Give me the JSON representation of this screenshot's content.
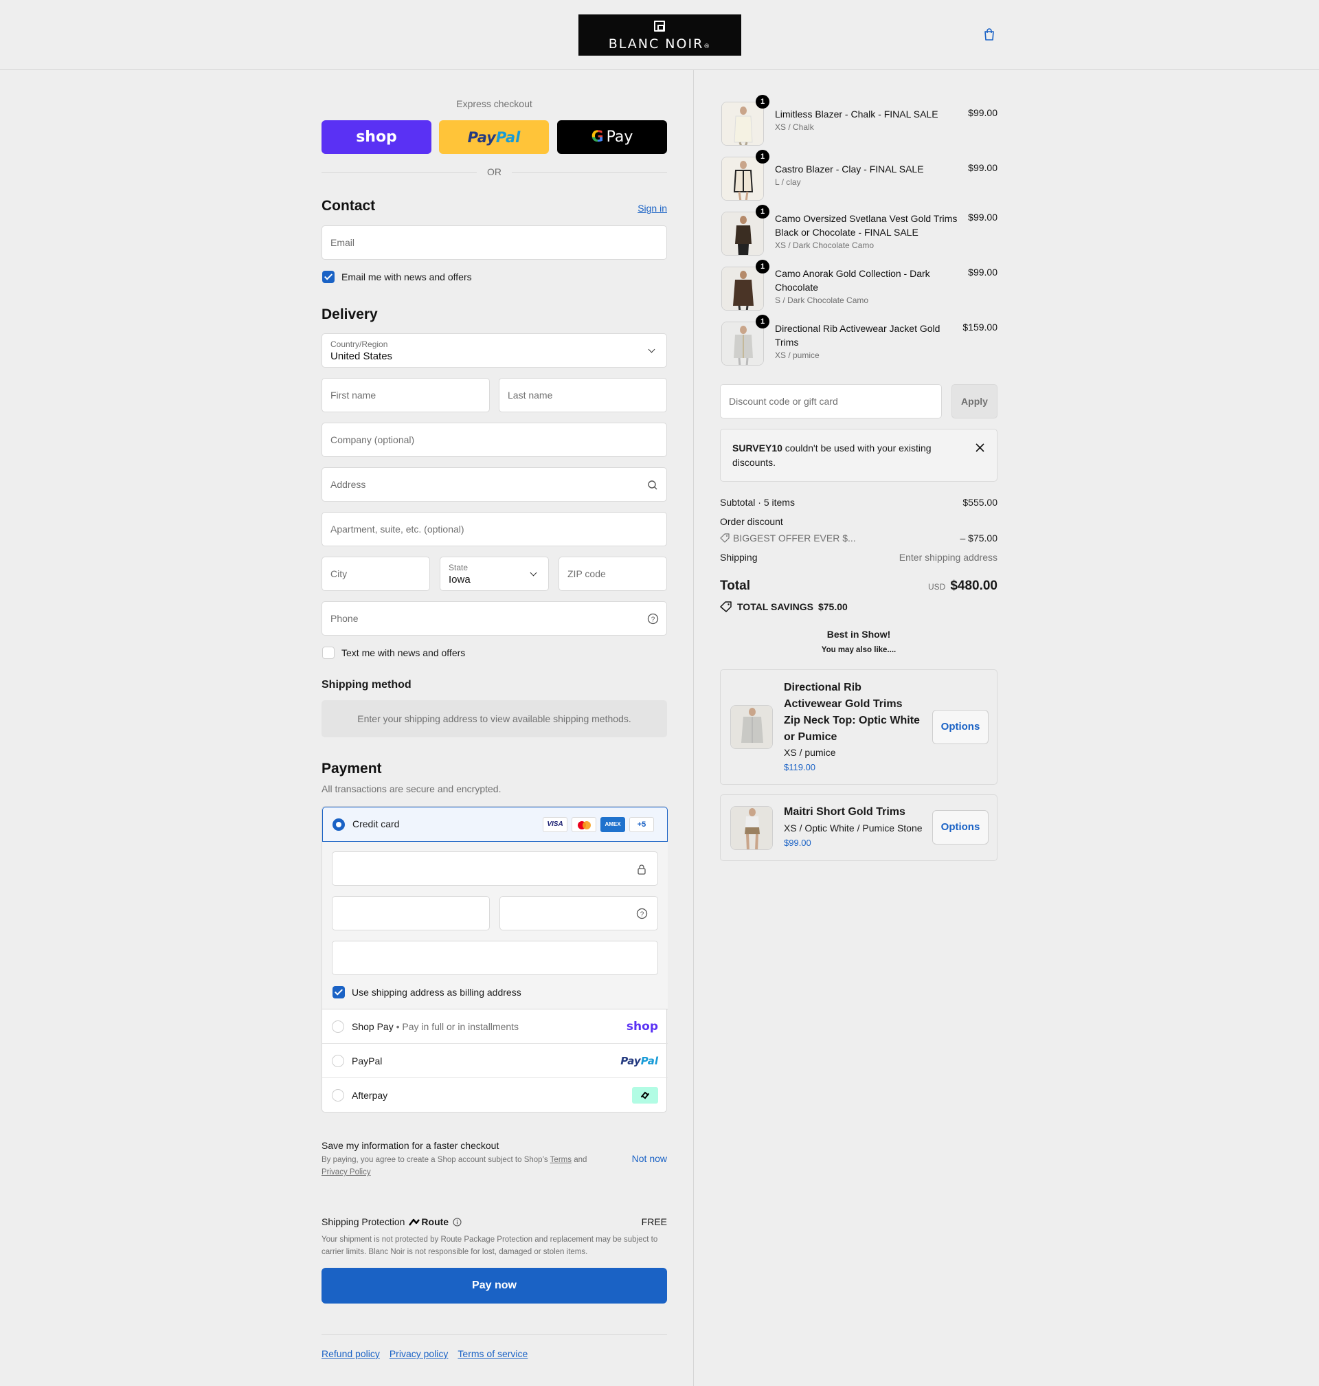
{
  "brand": {
    "name": "BLANC NOIR",
    "mark": "®"
  },
  "express": {
    "title": "Express checkout",
    "shop_label": "shop",
    "paypal_part1": "Pay",
    "paypal_part2": "Pal",
    "gpay_g": "G",
    "gpay_label": "Pay",
    "or": "OR"
  },
  "contact": {
    "heading": "Contact",
    "sign_in": "Sign in",
    "email_placeholder": "Email",
    "email_opt_in": "Email me with news and offers"
  },
  "delivery": {
    "heading": "Delivery",
    "country_label": "Country/Region",
    "country_value": "United States",
    "first_name": "First name",
    "last_name": "Last name",
    "company": "Company (optional)",
    "address": "Address",
    "apartment": "Apartment, suite, etc. (optional)",
    "city": "City",
    "state_label": "State",
    "state_value": "Iowa",
    "zip": "ZIP code",
    "phone": "Phone",
    "text_opt_in": "Text me with news and offers"
  },
  "shipping_method": {
    "heading": "Shipping method",
    "message": "Enter your shipping address to view available shipping methods."
  },
  "payment": {
    "heading": "Payment",
    "subtitle": "All transactions are secure and encrypted.",
    "credit_card": "Credit card",
    "card_logos": [
      "VISA",
      "MC",
      "AMEX",
      "+5"
    ],
    "billing_same": "Use shipping address as billing address",
    "shop_pay": "Shop Pay",
    "shop_pay_note": "Pay in full or in installments",
    "shop_pay_logo": "shop",
    "paypal": "PayPal",
    "paypal_logo_1": "Pay",
    "paypal_logo_2": "Pal",
    "afterpay": "Afterpay"
  },
  "save_info": {
    "title": "Save my information for a faster checkout",
    "legal_1": "By paying, you agree to create a Shop account subject to Shop’s",
    "terms": "Terms",
    "and": "and",
    "privacy": "Privacy Policy",
    "not_now": "Not now"
  },
  "protection": {
    "label": "Shipping Protection",
    "brand": "Route",
    "price": "FREE",
    "note": "Your shipment is not protected by Route Package Protection and replacement may be subject to carrier limits. Blanc Noir is not responsible for lost, damaged or stolen items."
  },
  "pay_now": "Pay now",
  "footer_links": [
    "Refund policy",
    "Privacy policy",
    "Terms of service"
  ],
  "cart": {
    "items": [
      {
        "qty": "1",
        "name": "Limitless Blazer - Chalk - FINAL SALE",
        "variant": "XS / Chalk",
        "price": "$99.00"
      },
      {
        "qty": "1",
        "name": "Castro Blazer - Clay - FINAL SALE",
        "variant": "L / clay",
        "price": "$99.00"
      },
      {
        "qty": "1",
        "name": "Camo Oversized Svetlana Vest Gold Trims Black or Chocolate - FINAL SALE",
        "variant": "XS / Dark Chocolate Camo",
        "price": "$99.00"
      },
      {
        "qty": "1",
        "name": "Camo Anorak Gold Collection - Dark Chocolate",
        "variant": "S / Dark Chocolate Camo",
        "price": "$99.00"
      },
      {
        "qty": "1",
        "name": "Directional Rib Activewear Jacket Gold Trims",
        "variant": "XS / pumice",
        "price": "$159.00"
      }
    ],
    "discount_placeholder": "Discount code or gift card",
    "apply": "Apply",
    "notice_code": "SURVEY10",
    "notice_text": " couldn't be used with your existing discounts.",
    "subtotal_label": "Subtotal · 5 items",
    "subtotal_value": "$555.00",
    "order_discount_label": "Order discount",
    "discount_code": "BIGGEST OFFER EVER $...",
    "discount_value": "– $75.00",
    "shipping_label": "Shipping",
    "shipping_value": "Enter shipping address",
    "total_label": "Total",
    "currency": "USD",
    "total_value": "$480.00",
    "savings_label": "TOTAL SAVINGS",
    "savings_value": "$75.00"
  },
  "upsell": {
    "title": "Best in Show!",
    "subtitle": "You may also like....",
    "products": [
      {
        "name": "Directional Rib Activewear Gold Trims Zip Neck Top: Optic White or Pumice",
        "variant": "XS / pumice",
        "price": "$119.00",
        "button": "Options"
      },
      {
        "name": "Maitri Short Gold Trims",
        "variant": "XS / Optic White / Pumice Stone",
        "price": "$99.00",
        "button": "Options"
      }
    ]
  },
  "colors": {
    "accent": "#1a62c5",
    "shop_purple": "#5a31f4",
    "paypal_yellow": "#ffc439",
    "background": "#eeeeee"
  }
}
